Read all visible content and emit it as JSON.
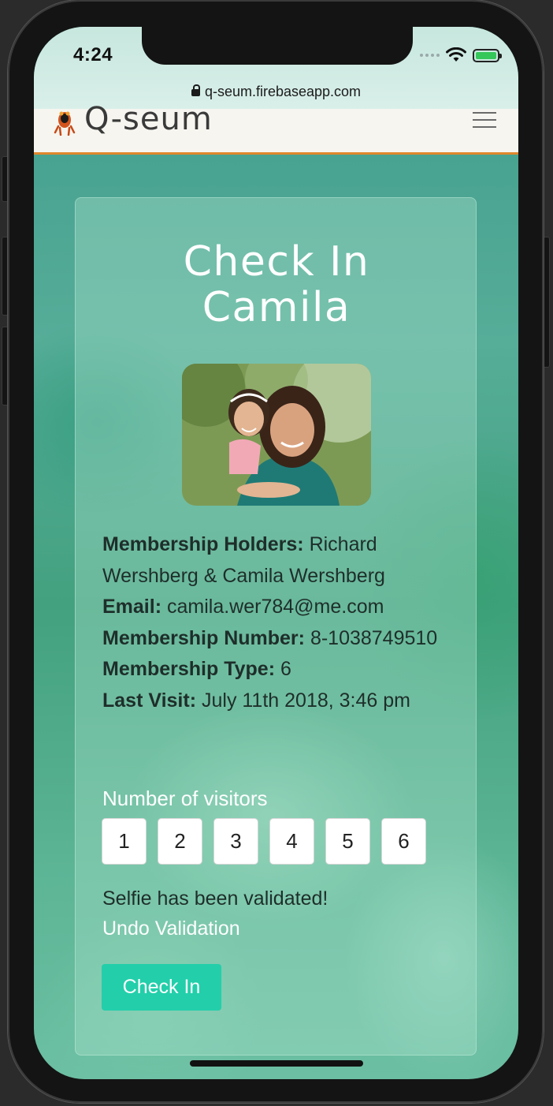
{
  "status_bar": {
    "time": "4:24",
    "url": "q-seum.firebaseapp.com"
  },
  "header": {
    "brand": "Q-seum",
    "icons": {
      "logo": "frog-logo-icon",
      "menu": "hamburger-menu-icon"
    }
  },
  "card": {
    "title_line1": "Check In",
    "title_line2": "Camila",
    "info": {
      "holders_label": "Membership Holders:",
      "holders_value": "Richard Wershberg & Camila Wershberg",
      "email_label": "Email:",
      "email_value": "camila.wer784@me.com",
      "number_label": "Membership Number:",
      "number_value": "8-1038749510",
      "type_label": "Membership Type:",
      "type_value": "6",
      "last_visit_label": "Last Visit:",
      "last_visit_value": "July 11th 2018, 3:46 pm"
    },
    "visitors_label": "Number of visitors",
    "visitor_options": [
      "1",
      "2",
      "3",
      "4",
      "5",
      "6"
    ],
    "selfie_status": "Selfie has been validated!",
    "undo_label": "Undo Validation",
    "checkin_label": "Check In"
  },
  "colors": {
    "accent_orange": "#e0872b",
    "checkin_green": "#22cfaa"
  }
}
